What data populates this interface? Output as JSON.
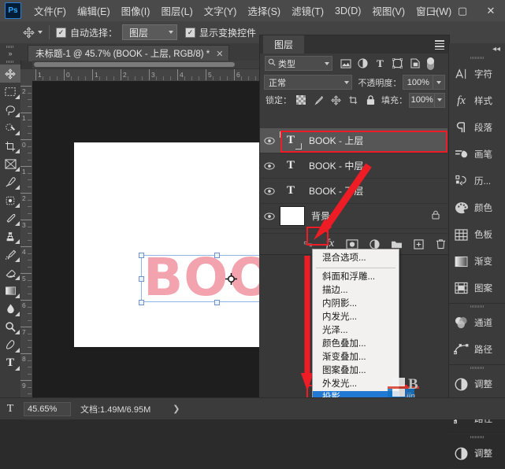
{
  "app": {
    "logo": "Ps",
    "menus": [
      "文件(F)",
      "编辑(E)",
      "图像(I)",
      "图层(L)",
      "文字(Y)",
      "选择(S)",
      "滤镜(T)",
      "3D(D)",
      "视图(V)",
      "窗口(W)"
    ],
    "window_controls": {
      "minimize": "─",
      "maximize": "▢",
      "close": "✕"
    }
  },
  "options_bar": {
    "tool_icon": "move-tool-icon",
    "auto_select_label": "自动选择：",
    "auto_select_checked": "✓",
    "auto_select_value": "图层",
    "show_transform_label": "显示变换控件",
    "show_transform_checked": "✓"
  },
  "toolbar": {
    "tools": [
      {
        "name": "move-tool",
        "icon": "move"
      },
      {
        "name": "rectangular-marquee-tool",
        "icon": "marquee"
      },
      {
        "name": "lasso-tool",
        "icon": "lasso"
      },
      {
        "name": "quick-selection-tool",
        "icon": "quickselect"
      },
      {
        "name": "crop-tool",
        "icon": "crop"
      },
      {
        "name": "frame-tool",
        "icon": "frame"
      },
      {
        "name": "eyedropper-tool",
        "icon": "eyedropper"
      },
      {
        "name": "spot-healing-brush-tool",
        "icon": "healing"
      },
      {
        "name": "brush-tool",
        "icon": "brush"
      },
      {
        "name": "clone-stamp-tool",
        "icon": "stamp"
      },
      {
        "name": "history-brush-tool",
        "icon": "historybrush"
      },
      {
        "name": "eraser-tool",
        "icon": "eraser"
      },
      {
        "name": "gradient-tool",
        "icon": "gradient"
      },
      {
        "name": "blur-tool",
        "icon": "blur"
      },
      {
        "name": "dodge-tool",
        "icon": "dodge"
      },
      {
        "name": "pen-tool",
        "icon": "pen"
      },
      {
        "name": "type-tool",
        "icon": "type"
      }
    ]
  },
  "document": {
    "tab_title": "未标题-1 @ 45.7% (BOOK  -  上层, RGB/8) *",
    "close_glyph": "✕",
    "canvas_text": "BOOK",
    "canvas_text_color": "#f3a3ad",
    "ruler_h_ticks": [
      "1",
      "0",
      "1",
      "2",
      "3",
      "4",
      "5",
      "6"
    ],
    "ruler_v_ticks": [
      "2",
      "1",
      "0",
      "1",
      "2",
      "3",
      "4",
      "5",
      "6",
      "7",
      "8",
      "9"
    ]
  },
  "status_bar": {
    "tool_glyph": "T",
    "zoom": "45.65%",
    "doc_info": "文档:1.49M/6.95M",
    "arrow": "❯"
  },
  "layers_panel": {
    "title": "图层",
    "filter": {
      "search_icon": "search-icon",
      "kind_value": "类型",
      "chevron": "⌄",
      "icons": [
        "pixel-filter-icon",
        "adjustment-filter-icon",
        "type-filter-icon",
        "shape-filter-icon",
        "smartobject-filter-icon"
      ],
      "toggle": "filter-toggle"
    },
    "blend": {
      "mode": "正常",
      "opacity_label": "不透明度：",
      "opacity_value": "100%"
    },
    "lock": {
      "label": "锁定：",
      "icons": [
        "lock-transparent-icon",
        "lock-image-icon",
        "lock-position-icon",
        "lock-artboard-icon",
        "lock-all-icon"
      ],
      "fill_label": "填充：",
      "fill_value": "100%"
    },
    "layers": [
      {
        "name": "BOOK  -  上层",
        "type": "text",
        "visible": true,
        "selected": true,
        "locked": false
      },
      {
        "name": "BOOK  -  中层",
        "type": "text",
        "visible": true,
        "selected": false,
        "locked": false
      },
      {
        "name": "BOOK  -  下层",
        "type": "text",
        "visible": true,
        "selected": false,
        "locked": false
      },
      {
        "name": "背景",
        "type": "image",
        "visible": true,
        "selected": false,
        "locked": true
      }
    ],
    "bottom_buttons": [
      "link-layers-icon",
      "layer-style-fx-icon",
      "layer-mask-icon",
      "adjustment-layer-icon",
      "new-group-icon",
      "new-layer-icon",
      "delete-layer-icon"
    ]
  },
  "context_menu": {
    "items": [
      {
        "label": "混合选项...",
        "separator_after": true,
        "active": false
      },
      {
        "label": "斜面和浮雕...",
        "active": false
      },
      {
        "label": "描边...",
        "active": false
      },
      {
        "label": "内阴影...",
        "active": false
      },
      {
        "label": "内发光...",
        "active": false
      },
      {
        "label": "光泽...",
        "active": false
      },
      {
        "label": "颜色叠加...",
        "active": false
      },
      {
        "label": "渐变叠加...",
        "active": false
      },
      {
        "label": "图案叠加...",
        "active": false
      },
      {
        "label": "外发光...",
        "active": false
      },
      {
        "label": "投影...",
        "active": true
      }
    ]
  },
  "right_dock": {
    "collapse_glyph": "◂◂",
    "groups": [
      {
        "items": [
          {
            "label": "字符",
            "icon": "character-icon"
          },
          {
            "label": "样式",
            "icon": "styles-fx-icon"
          },
          {
            "label": "段落",
            "icon": "paragraph-icon"
          },
          {
            "label": "画笔",
            "icon": "brushes-icon"
          },
          {
            "label": "历...",
            "icon": "history-icon"
          },
          {
            "label": "颜色",
            "icon": "color-icon"
          },
          {
            "label": "色板",
            "icon": "swatches-icon"
          },
          {
            "label": "渐变",
            "icon": "gradients-icon"
          },
          {
            "label": "图案",
            "icon": "patterns-icon"
          }
        ]
      },
      {
        "items": [
          {
            "label": "通道",
            "icon": "channels-icon"
          },
          {
            "label": "路径",
            "icon": "paths-icon"
          }
        ]
      },
      {
        "items": [
          {
            "label": "调整",
            "icon": "adjustments-icon"
          }
        ]
      },
      {
        "items": [
          {
            "label": "路径",
            "icon": "paths-icon"
          }
        ]
      },
      {
        "items": [
          {
            "label": "调整",
            "icon": "adjustments-icon"
          }
        ]
      }
    ]
  },
  "annotations": {
    "highlight_color": "#ee1c25",
    "arrow_color": "#ee1c25"
  }
}
